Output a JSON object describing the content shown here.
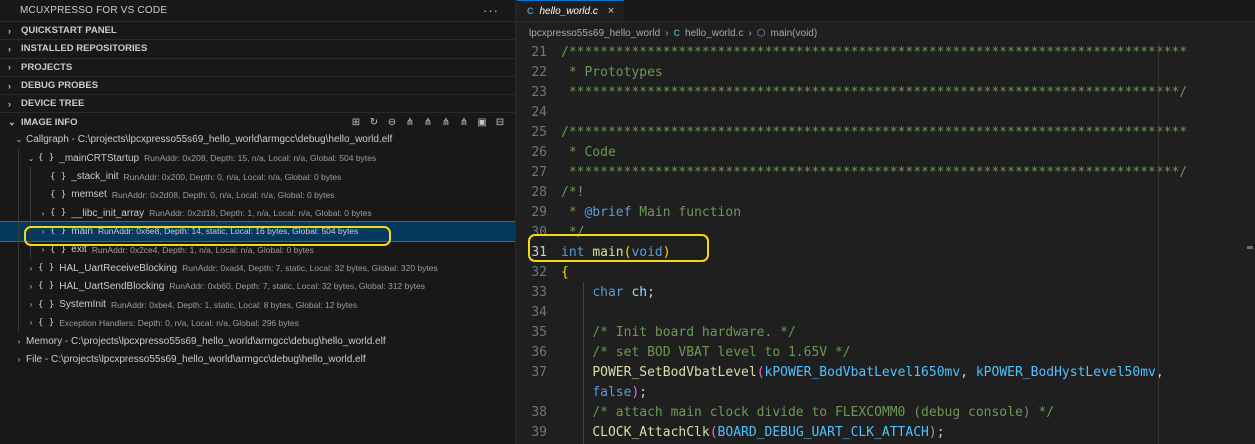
{
  "left_panel": {
    "title": "MCUXPRESSO FOR VS CODE",
    "more": "···",
    "sections": [
      {
        "label": "QUICKSTART PANEL",
        "expanded": false
      },
      {
        "label": "INSTALLED REPOSITORIES",
        "expanded": false
      },
      {
        "label": "PROJECTS",
        "expanded": false
      },
      {
        "label": "DEBUG PROBES",
        "expanded": false
      },
      {
        "label": "DEVICE TREE",
        "expanded": false
      },
      {
        "label": "IMAGE INFO",
        "expanded": true
      }
    ],
    "toolbar_icons": [
      "new-file-icon",
      "refresh-icon",
      "collapse-icon",
      "tree-icon",
      "tree-alt-icon",
      "tree-expand-icon",
      "tree-collapse-icon",
      "report-icon",
      "collapse-all-icon"
    ],
    "tree": [
      {
        "name": "Callgraph - C:\\projects\\lpcxpresso55s69_hello_world\\armgcc\\debug\\hello_world.elf",
        "desc": "",
        "twist": "v",
        "braces": false,
        "indent": 0
      },
      {
        "name": "_mainCRTStartup",
        "desc": "RunAddr: 0x208, Depth: 15, n/a, Local: n/a, Global: 504 bytes",
        "twist": "v",
        "braces": true,
        "indent": 1
      },
      {
        "name": "_stack_init",
        "desc": "RunAddr: 0x200, Depth: 0, n/a, Local: n/a, Global: 0 bytes",
        "twist": "",
        "braces": true,
        "indent": 2
      },
      {
        "name": "memset",
        "desc": "RunAddr: 0x2d08, Depth: 0, n/a, Local: n/a, Global: 0 bytes",
        "twist": "",
        "braces": true,
        "indent": 2
      },
      {
        "name": "__libc_init_array",
        "desc": "RunAddr: 0x2d18, Depth: 1, n/a, Local: n/a, Global: 0 bytes",
        "twist": ">",
        "braces": true,
        "indent": 2
      },
      {
        "name": "main",
        "desc": "RunAddr: 0x6e8, Depth: 14, static, Local: 16 bytes, Global: 504 bytes",
        "twist": ">",
        "braces": true,
        "indent": 2,
        "selected": true
      },
      {
        "name": "exit",
        "desc": "RunAddr: 0x2ce4, Depth: 1, n/a, Local: n/a, Global: 0 bytes",
        "twist": ">",
        "braces": true,
        "indent": 2
      },
      {
        "name": "HAL_UartReceiveBlocking",
        "desc": "RunAddr: 0xad4, Depth: 7, static, Local: 32 bytes, Global: 320 bytes",
        "twist": ">",
        "braces": true,
        "indent": 1
      },
      {
        "name": "HAL_UartSendBlocking",
        "desc": "RunAddr: 0xb60, Depth: 7, static, Local: 32 bytes, Global: 312 bytes",
        "twist": ">",
        "braces": true,
        "indent": 1
      },
      {
        "name": "SystemInit",
        "desc": "RunAddr: 0xbe4, Depth: 1, static, Local: 8 bytes, Global: 12 bytes",
        "twist": ">",
        "braces": true,
        "indent": 1
      },
      {
        "name": "",
        "desc": "Exception Handlers: Depth: 0, n/a, Local: n/a, Global: 296 bytes",
        "twist": ">",
        "braces": true,
        "indent": 1
      },
      {
        "name": "Memory - C:\\projects\\lpcxpresso55s69_hello_world\\armgcc\\debug\\hello_world.elf",
        "desc": "",
        "twist": ">",
        "braces": false,
        "indent": 0
      },
      {
        "name": "File - C:\\projects\\lpcxpresso55s69_hello_world\\armgcc\\debug\\hello_world.elf",
        "desc": "",
        "twist": ">",
        "braces": false,
        "indent": 0
      }
    ]
  },
  "editor": {
    "tab": {
      "icon": "C",
      "label": "hello_world.c",
      "close": "×"
    },
    "breadcrumb": {
      "folder": "lpcxpresso55s69_hello_world",
      "file_icon": "C",
      "file": "hello_world.c",
      "symbol": "main(void)"
    },
    "current_line": 31,
    "lines": [
      {
        "n": "21",
        "tokens": [
          [
            "cmt",
            "/*******************************************************************************"
          ]
        ],
        "indent": 0
      },
      {
        "n": "22",
        "tokens": [
          [
            "cmt",
            " * Prototypes"
          ]
        ],
        "indent": 0
      },
      {
        "n": "23",
        "tokens": [
          [
            "cmt",
            " ******************************************************************************/"
          ]
        ],
        "indent": 0
      },
      {
        "n": "24",
        "tokens": [],
        "indent": 0
      },
      {
        "n": "25",
        "tokens": [
          [
            "cmt",
            "/*******************************************************************************"
          ]
        ],
        "indent": 0
      },
      {
        "n": "26",
        "tokens": [
          [
            "cmt",
            " * Code"
          ]
        ],
        "indent": 0
      },
      {
        "n": "27",
        "tokens": [
          [
            "cmt",
            " ******************************************************************************/"
          ]
        ],
        "indent": 0
      },
      {
        "n": "28",
        "tokens": [
          [
            "cmt",
            "/*!"
          ]
        ],
        "indent": 0
      },
      {
        "n": "29",
        "tokens": [
          [
            "cmt",
            " * "
          ],
          [
            "kw",
            "@brief"
          ],
          [
            "cmt",
            " Main function"
          ]
        ],
        "indent": 0
      },
      {
        "n": "30",
        "tokens": [
          [
            "cmt",
            " */"
          ]
        ],
        "indent": 0
      },
      {
        "n": "31",
        "tokens": [
          [
            "ty",
            "int"
          ],
          [
            "pn",
            " "
          ],
          [
            "fn",
            "main"
          ],
          [
            "br1",
            "("
          ],
          [
            "ty",
            "void"
          ],
          [
            "br1",
            ")"
          ]
        ],
        "indent": 0
      },
      {
        "n": "32",
        "tokens": [
          [
            "br1",
            "{"
          ]
        ],
        "indent": 0
      },
      {
        "n": "33",
        "tokens": [
          [
            "pn",
            "    "
          ],
          [
            "ty",
            "char"
          ],
          [
            "pn",
            " "
          ],
          [
            "id",
            "ch"
          ],
          [
            "pn",
            ";"
          ]
        ],
        "indent": 0
      },
      {
        "n": "34",
        "tokens": [],
        "indent": 0
      },
      {
        "n": "35",
        "tokens": [
          [
            "pn",
            "    "
          ],
          [
            "cmt",
            "/* Init board hardware. */"
          ]
        ],
        "indent": 0
      },
      {
        "n": "36",
        "tokens": [
          [
            "pn",
            "    "
          ],
          [
            "cmt",
            "/* set BOD VBAT level to 1.65V */"
          ]
        ],
        "indent": 0
      },
      {
        "n": "37",
        "tokens": [
          [
            "pn",
            "    "
          ],
          [
            "fn",
            "POWER_SetBodVbatLevel"
          ],
          [
            "br2",
            "("
          ],
          [
            "en",
            "kPOWER_BodVbatLevel1650mv"
          ],
          [
            "pn",
            ", "
          ],
          [
            "en",
            "kPOWER_BodHystLevel50mv"
          ],
          [
            "pn",
            ","
          ]
        ],
        "indent": 0
      },
      {
        "n": "",
        "tokens": [
          [
            "pn",
            "    "
          ],
          [
            "kw",
            "false"
          ],
          [
            "br2",
            ")"
          ],
          [
            "pn",
            ";"
          ]
        ],
        "indent": 0
      },
      {
        "n": "38",
        "tokens": [
          [
            "pn",
            "    "
          ],
          [
            "cmt",
            "/* attach main clock divide to FLEXCOMM0 (debug console) */"
          ]
        ],
        "indent": 0
      },
      {
        "n": "39",
        "tokens": [
          [
            "pn",
            "    "
          ],
          [
            "fn",
            "CLOCK_AttachClk"
          ],
          [
            "br2",
            "("
          ],
          [
            "en",
            "BOARD_DEBUG_UART_CLK_ATTACH"
          ],
          [
            "br2",
            ")"
          ],
          [
            "pn",
            ";"
          ]
        ],
        "indent": 0
      }
    ]
  }
}
